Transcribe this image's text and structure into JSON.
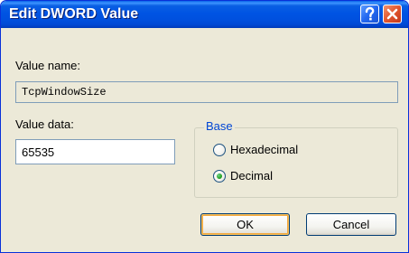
{
  "window": {
    "title": "Edit DWORD Value",
    "help_icon": "question-mark-icon",
    "close_icon": "close-x-icon",
    "help_color": "#2267f0",
    "close_color": "#e2552d",
    "titlebar_color": "#0054e3"
  },
  "value_name": {
    "label": "Value name:",
    "value": "TcpWindowSize"
  },
  "value_data": {
    "label": "Value data:",
    "value": "65535"
  },
  "base": {
    "legend": "Base",
    "selected": "Decimal",
    "options": [
      {
        "label": "Hexadecimal",
        "checked": false
      },
      {
        "label": "Decimal",
        "checked": true
      }
    ]
  },
  "buttons": {
    "ok": "OK",
    "cancel": "Cancel"
  }
}
